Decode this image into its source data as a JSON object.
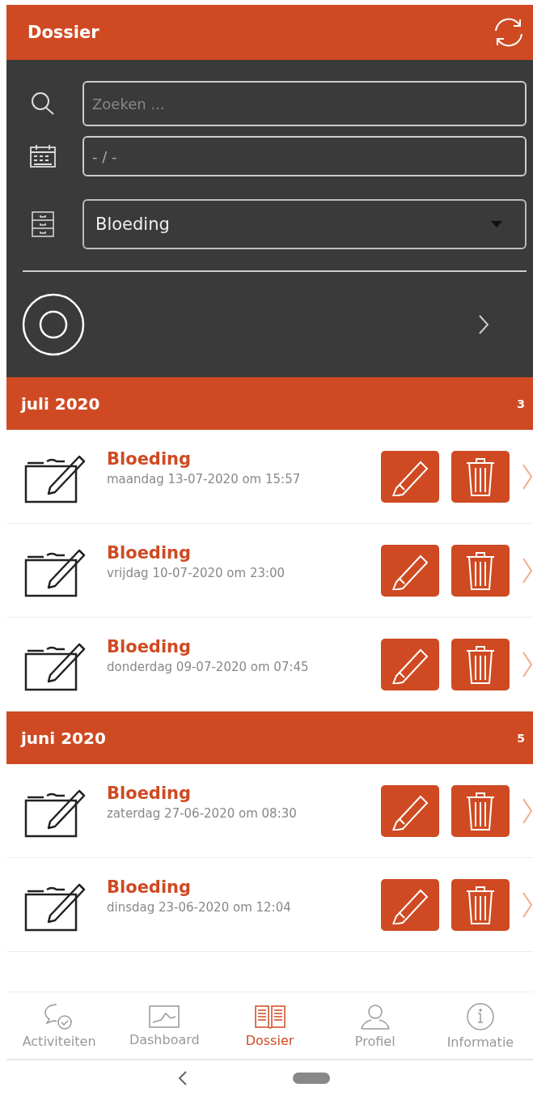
{
  "header": {
    "title": "Dossier"
  },
  "filters": {
    "search": {
      "placeholder": "Zoeken ..."
    },
    "date": {
      "value": "- / -"
    },
    "category": {
      "value": "Bloeding"
    }
  },
  "groups": [
    {
      "label": "juli 2020",
      "count": "3",
      "entries": [
        {
          "title": "Bloeding",
          "date": "maandag 13-07-2020 om 15:57"
        },
        {
          "title": "Bloeding",
          "date": "vrijdag 10-07-2020 om 23:00"
        },
        {
          "title": "Bloeding",
          "date": "donderdag 09-07-2020 om 07:45"
        }
      ]
    },
    {
      "label": "juni 2020",
      "count": "5",
      "entries": [
        {
          "title": "Bloeding",
          "date": "zaterdag 27-06-2020 om 08:30"
        },
        {
          "title": "Bloeding",
          "date": "dinsdag 23-06-2020 om 12:04"
        }
      ]
    }
  ],
  "tabs": [
    {
      "kind": "activities",
      "label": "Activiteiten",
      "selected": false
    },
    {
      "kind": "dashboard",
      "label": "Dashboard",
      "selected": false
    },
    {
      "kind": "dossier",
      "label": "Dossier",
      "selected": true
    },
    {
      "kind": "profile",
      "label": "Profiel",
      "selected": false
    },
    {
      "kind": "info",
      "label": "Informatie",
      "selected": false
    }
  ]
}
